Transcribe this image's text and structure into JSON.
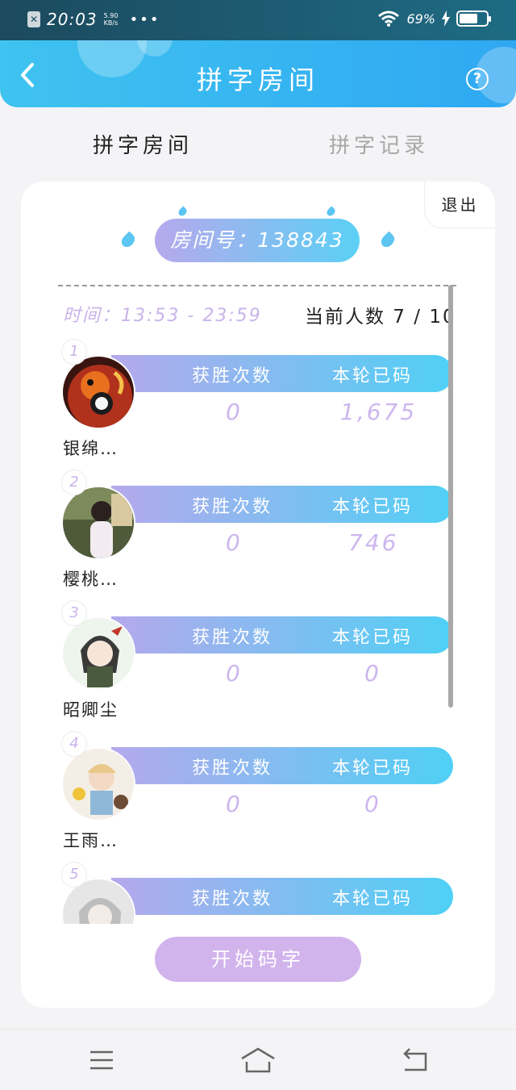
{
  "status_bar": {
    "time": "20:03",
    "speed_value": "5.90",
    "speed_unit": "KB/s",
    "more": "•••",
    "battery": "69%"
  },
  "header": {
    "title": "拼字房间",
    "help": "?"
  },
  "tabs": [
    {
      "label": "拼字房间",
      "active": true
    },
    {
      "label": "拼字记录",
      "active": false
    }
  ],
  "room": {
    "exit_label": "退出",
    "room_number": "房间号：138843",
    "time": "时间：13:53 - 23:59",
    "player_count": "当前人数 7 / 10",
    "stat_labels": {
      "wins": "获胜次数",
      "typed": "本轮已码"
    },
    "players": [
      {
        "rank": "1",
        "name": "银绵…",
        "wins": "0",
        "typed": "1,675"
      },
      {
        "rank": "2",
        "name": "樱桃…",
        "wins": "0",
        "typed": "746"
      },
      {
        "rank": "3",
        "name": "昭卿尘",
        "wins": "0",
        "typed": "0"
      },
      {
        "rank": "4",
        "name": "王雨…",
        "wins": "0",
        "typed": "0"
      },
      {
        "rank": "5",
        "name": "",
        "wins": "",
        "typed": ""
      }
    ],
    "start_button": "开始码字"
  },
  "colors": {
    "header_start": "#3fc3f0",
    "header_end": "#2fa8f2",
    "pill_start": "#b6a9ec",
    "pill_end": "#5bd0f5",
    "accent_purple": "#c9b3ea",
    "start_button": "#d2b4ed"
  }
}
